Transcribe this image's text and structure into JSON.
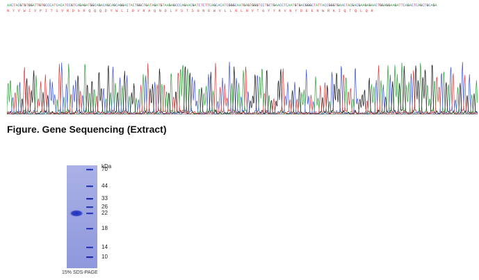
{
  "sequence": {
    "dna": "AACTACGTGTGGATTGTGCCCATCACATCCGTCAGAGATGGCAGACAGCAGCAGGACTACTGGCTGATAGATGTAAGAGCCCAGAACGATCTCTTCAGCACATCGGGCAATGAGTGGGTCCTGCTGAACCTCAATGTGACGGGCTATTACCGGGTGAACTACGACGAAGAGAACTGGAGGAAGATTCAGACTCAGCTGCAGA",
    "protein": "NYVWIVPITSVRDGRQQQDYWLIDVRAQNDLFSTSGNEWVLLNLNVTGYYRVNYDEENWRKIQTQLQR",
    "base_colors": {
      "A": "#2e9e3a",
      "C": "#3b52c8",
      "G": "#111111",
      "T": "#d23b3b"
    }
  },
  "figure": {
    "title": "Figure. Gene Sequencing (Extract)"
  },
  "gel": {
    "unit_label": "kDa",
    "markers": [
      "70",
      "44",
      "33",
      "26",
      "22",
      "18",
      "14",
      "10"
    ],
    "caption": "15% SDS-PAGE"
  }
}
